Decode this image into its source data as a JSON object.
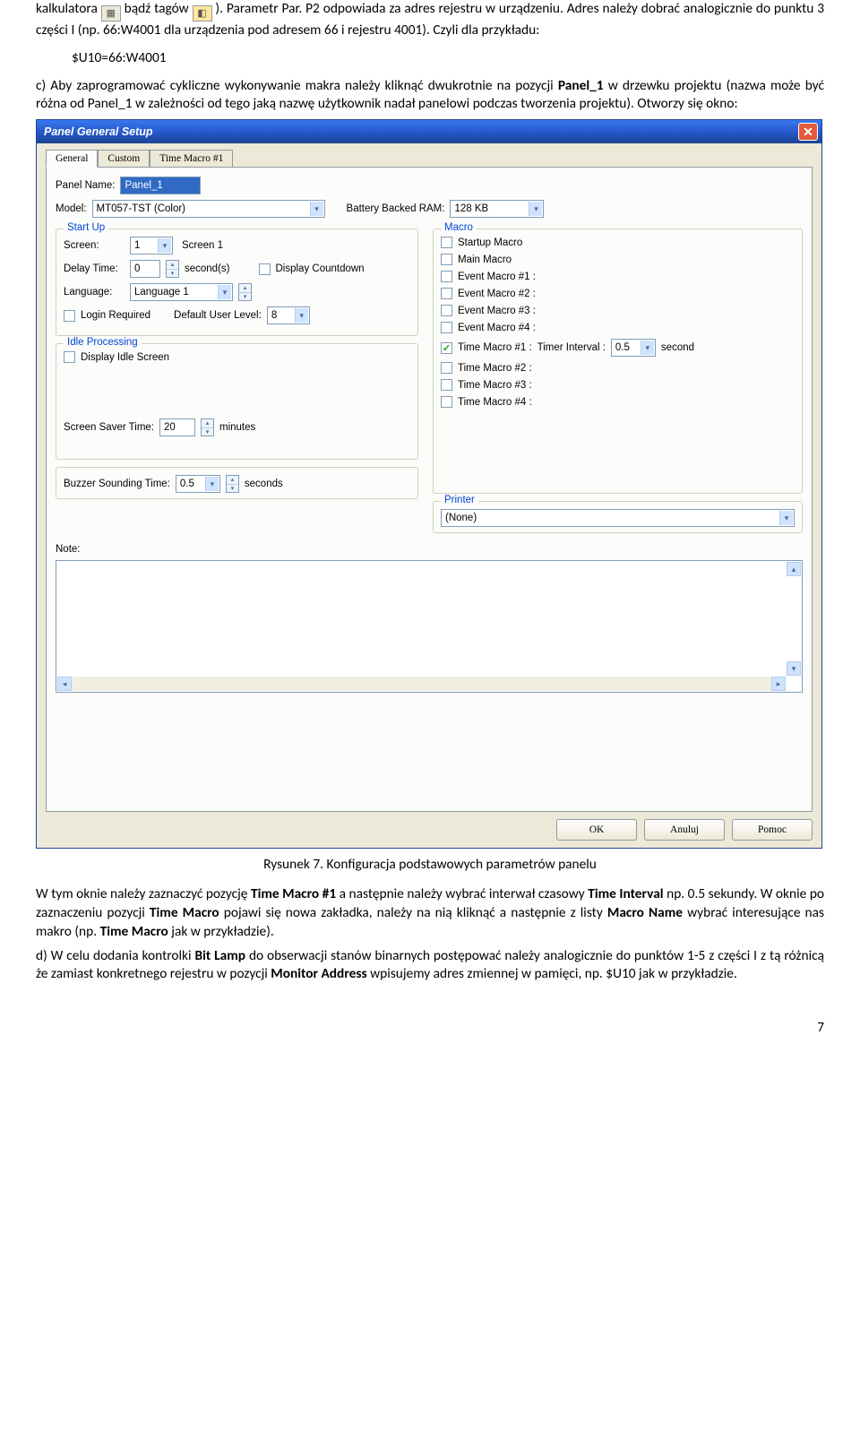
{
  "doc": {
    "p1_a": "kalkulatora ",
    "p1_b": " bądź tagów ",
    "p1_c": "). Parametr Par. P2 odpowiada za adres rejestru w urządzeniu. Adres należy dobrać analogicznie do punktu 3 części I (np. 66:W4001 dla urządzenia pod adresem 66 i rejestru 4001). Czyli dla przykładu:",
    "code1": "$U10=66:W4001",
    "p2_a": "c) Aby zaprogramować cykliczne wykonywanie makra należy kliknąć dwukrotnie na pozycji ",
    "p2_b": "Panel_1",
    "p2_c": " w drzewku projektu (nazwa może być różna od Panel_1 w zależności od tego jaką nazwę użytkownik nadał panelowi podczas tworzenia projektu). Otworzy się okno:",
    "caption": "Rysunek 7. Konfiguracja podstawowych parametrów panelu",
    "p3_a": "W tym oknie należy zaznaczyć pozycję ",
    "p3_b": "Time Macro #1",
    "p3_c": " a następnie należy wybrać interwał czasowy ",
    "p3_d": "Time Interval",
    "p3_e": " np. 0.5 sekundy. W oknie po zaznaczeniu pozycji ",
    "p3_f": "Time Macro",
    "p3_g": " pojawi się nowa zakładka, należy na nią kliknąć a następnie z listy ",
    "p3_h": "Macro Name",
    "p3_i": " wybrać interesujące nas makro (np. ",
    "p3_j": "Time Macro",
    "p3_k": " jak w przykładzie).",
    "p4_a": "d) W celu dodania kontrolki ",
    "p4_b": "Bit Lamp",
    "p4_c": " do obserwacji stanów binarnych postępować należy analogicznie do punktów 1-5 z części I z tą różnicą że zamiast konkretnego rejestru w pozycji ",
    "p4_d": "Monitor Address",
    "p4_e": " wpisujemy adres zmiennej w pamięci, np. $U10 jak w przykładzie.",
    "pagenum": "7"
  },
  "dlg": {
    "title": "Panel General Setup",
    "tabs": {
      "general": "General",
      "custom": "Custom",
      "timeMacro": "Time Macro #1"
    },
    "panelName": {
      "label": "Panel Name:",
      "value": "Panel_1"
    },
    "model": {
      "label": "Model:",
      "value": "MT057-TST (Color)"
    },
    "battery": {
      "label": "Battery Backed RAM:",
      "value": "128 KB"
    },
    "startUp": {
      "legend": "Start Up",
      "screenLbl": "Screen:",
      "screenNum": "1",
      "screenName": "Screen 1",
      "delayLbl": "Delay Time:",
      "delayVal": "0",
      "delayUnit": "second(s)",
      "displayCountdown": "Display Countdown",
      "languageLbl": "Language:",
      "languageVal": "Language 1",
      "loginReq": "Login Required",
      "defUserLevelLbl": "Default User Level:",
      "defUserLevelVal": "8"
    },
    "idle": {
      "legend": "Idle Processing",
      "displayIdle": "Display Idle Screen",
      "screenSaverLbl": "Screen Saver Time:",
      "screenSaverVal": "20",
      "screenSaverUnit": "minutes"
    },
    "buzzer": {
      "label": "Buzzer Sounding Time:",
      "value": "0.5",
      "unit": "seconds"
    },
    "macro": {
      "legend": "Macro",
      "startup": "Startup Macro",
      "main": "Main Macro",
      "e1": "Event Macro #1 :",
      "e2": "Event Macro #2 :",
      "e3": "Event Macro #3 :",
      "e4": "Event Macro #4 :",
      "t1": "Time Macro #1 :",
      "timerIntervalLbl": "Timer Interval :",
      "timerIntervalVal": "0.5",
      "timerIntervalUnit": "second",
      "t2": "Time Macro #2 :",
      "t3": "Time Macro #3 :",
      "t4": "Time Macro #4 :"
    },
    "printer": {
      "legend": "Printer",
      "value": "(None)"
    },
    "noteLbl": "Note:",
    "buttons": {
      "ok": "OK",
      "cancel": "Anuluj",
      "help": "Pomoc"
    }
  }
}
